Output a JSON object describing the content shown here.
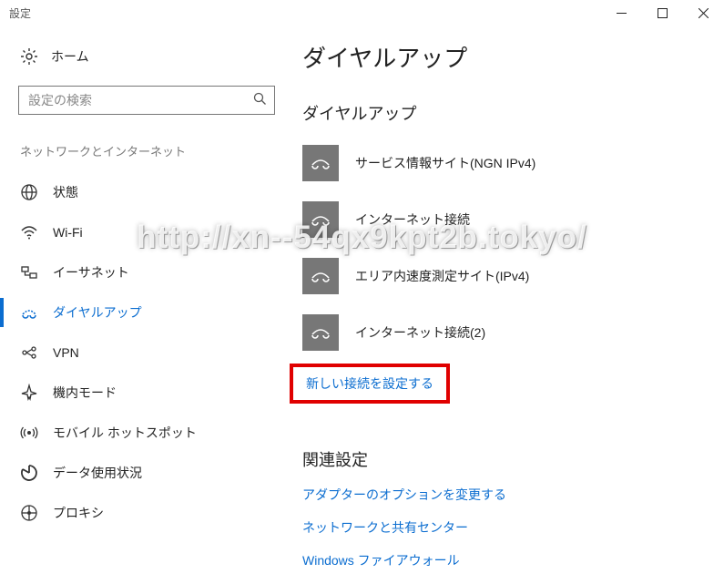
{
  "window": {
    "title": "設定"
  },
  "sidebar": {
    "home": "ホーム",
    "search_placeholder": "設定の検索",
    "category": "ネットワークとインターネット",
    "items": [
      {
        "icon": "globe-icon",
        "label": "状態"
      },
      {
        "icon": "wifi-icon",
        "label": "Wi-Fi"
      },
      {
        "icon": "ethernet-icon",
        "label": "イーサネット"
      },
      {
        "icon": "dialup-icon",
        "label": "ダイヤルアップ"
      },
      {
        "icon": "vpn-icon",
        "label": "VPN"
      },
      {
        "icon": "airplane-icon",
        "label": "機内モード"
      },
      {
        "icon": "hotspot-icon",
        "label": "モバイル ホットスポット"
      },
      {
        "icon": "datausage-icon",
        "label": "データ使用状況"
      },
      {
        "icon": "proxy-icon",
        "label": "プロキシ"
      }
    ],
    "active_index": 3
  },
  "content": {
    "title": "ダイヤルアップ",
    "section_title": "ダイヤルアップ",
    "connections": [
      {
        "label": "サービス情報サイト(NGN IPv4)"
      },
      {
        "label": "インターネット接続"
      },
      {
        "label": "エリア内速度測定サイト(IPv4)"
      },
      {
        "label": "インターネット接続(2)"
      }
    ],
    "new_connection_link": "新しい接続を設定する",
    "related_title": "関連設定",
    "related_links": [
      "アダプターのオプションを変更する",
      "ネットワークと共有センター",
      "Windows ファイアウォール"
    ]
  },
  "watermark": "http://xn--54qx9kpt2b.tokyo/"
}
